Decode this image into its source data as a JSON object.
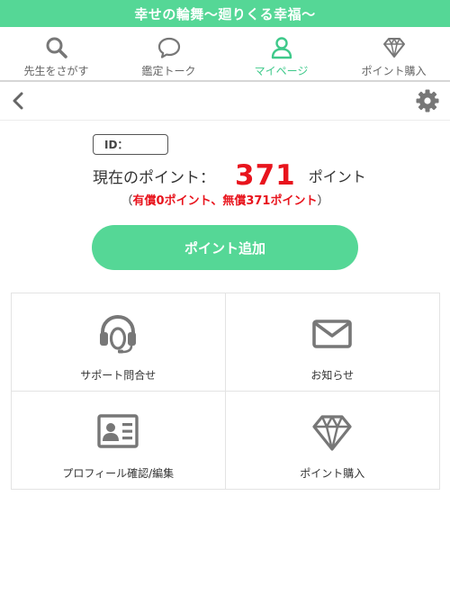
{
  "app": {
    "title": "幸せの輪舞〜廻りくる幸福〜"
  },
  "nav": {
    "items": [
      {
        "label": "先生をさがす",
        "icon": "search-icon"
      },
      {
        "label": "鑑定トーク",
        "icon": "chat-bubble-icon"
      },
      {
        "label": "マイページ",
        "icon": "user-icon",
        "active": true
      },
      {
        "label": "ポイント購入",
        "icon": "diamond-icon"
      }
    ]
  },
  "colors": {
    "accent": "#55d796",
    "points_red": "#e8141d",
    "icon_gray": "#777777"
  },
  "account": {
    "id_label": "ID："
  },
  "points": {
    "label": "現在のポイント：",
    "value": "371",
    "unit": "ポイント",
    "open_paren": "（",
    "breakdown": "有償0ポイント、無償371ポイント",
    "close_paren": "）"
  },
  "actions": {
    "add_points": "ポイント追加"
  },
  "menu": {
    "tiles": [
      {
        "label": "サポート問合せ",
        "icon": "headset-icon"
      },
      {
        "label": "お知らせ",
        "icon": "envelope-icon"
      },
      {
        "label": "プロフィール確認/編集",
        "icon": "profile-card-icon"
      },
      {
        "label": "ポイント購入",
        "icon": "diamond-icon"
      }
    ]
  }
}
